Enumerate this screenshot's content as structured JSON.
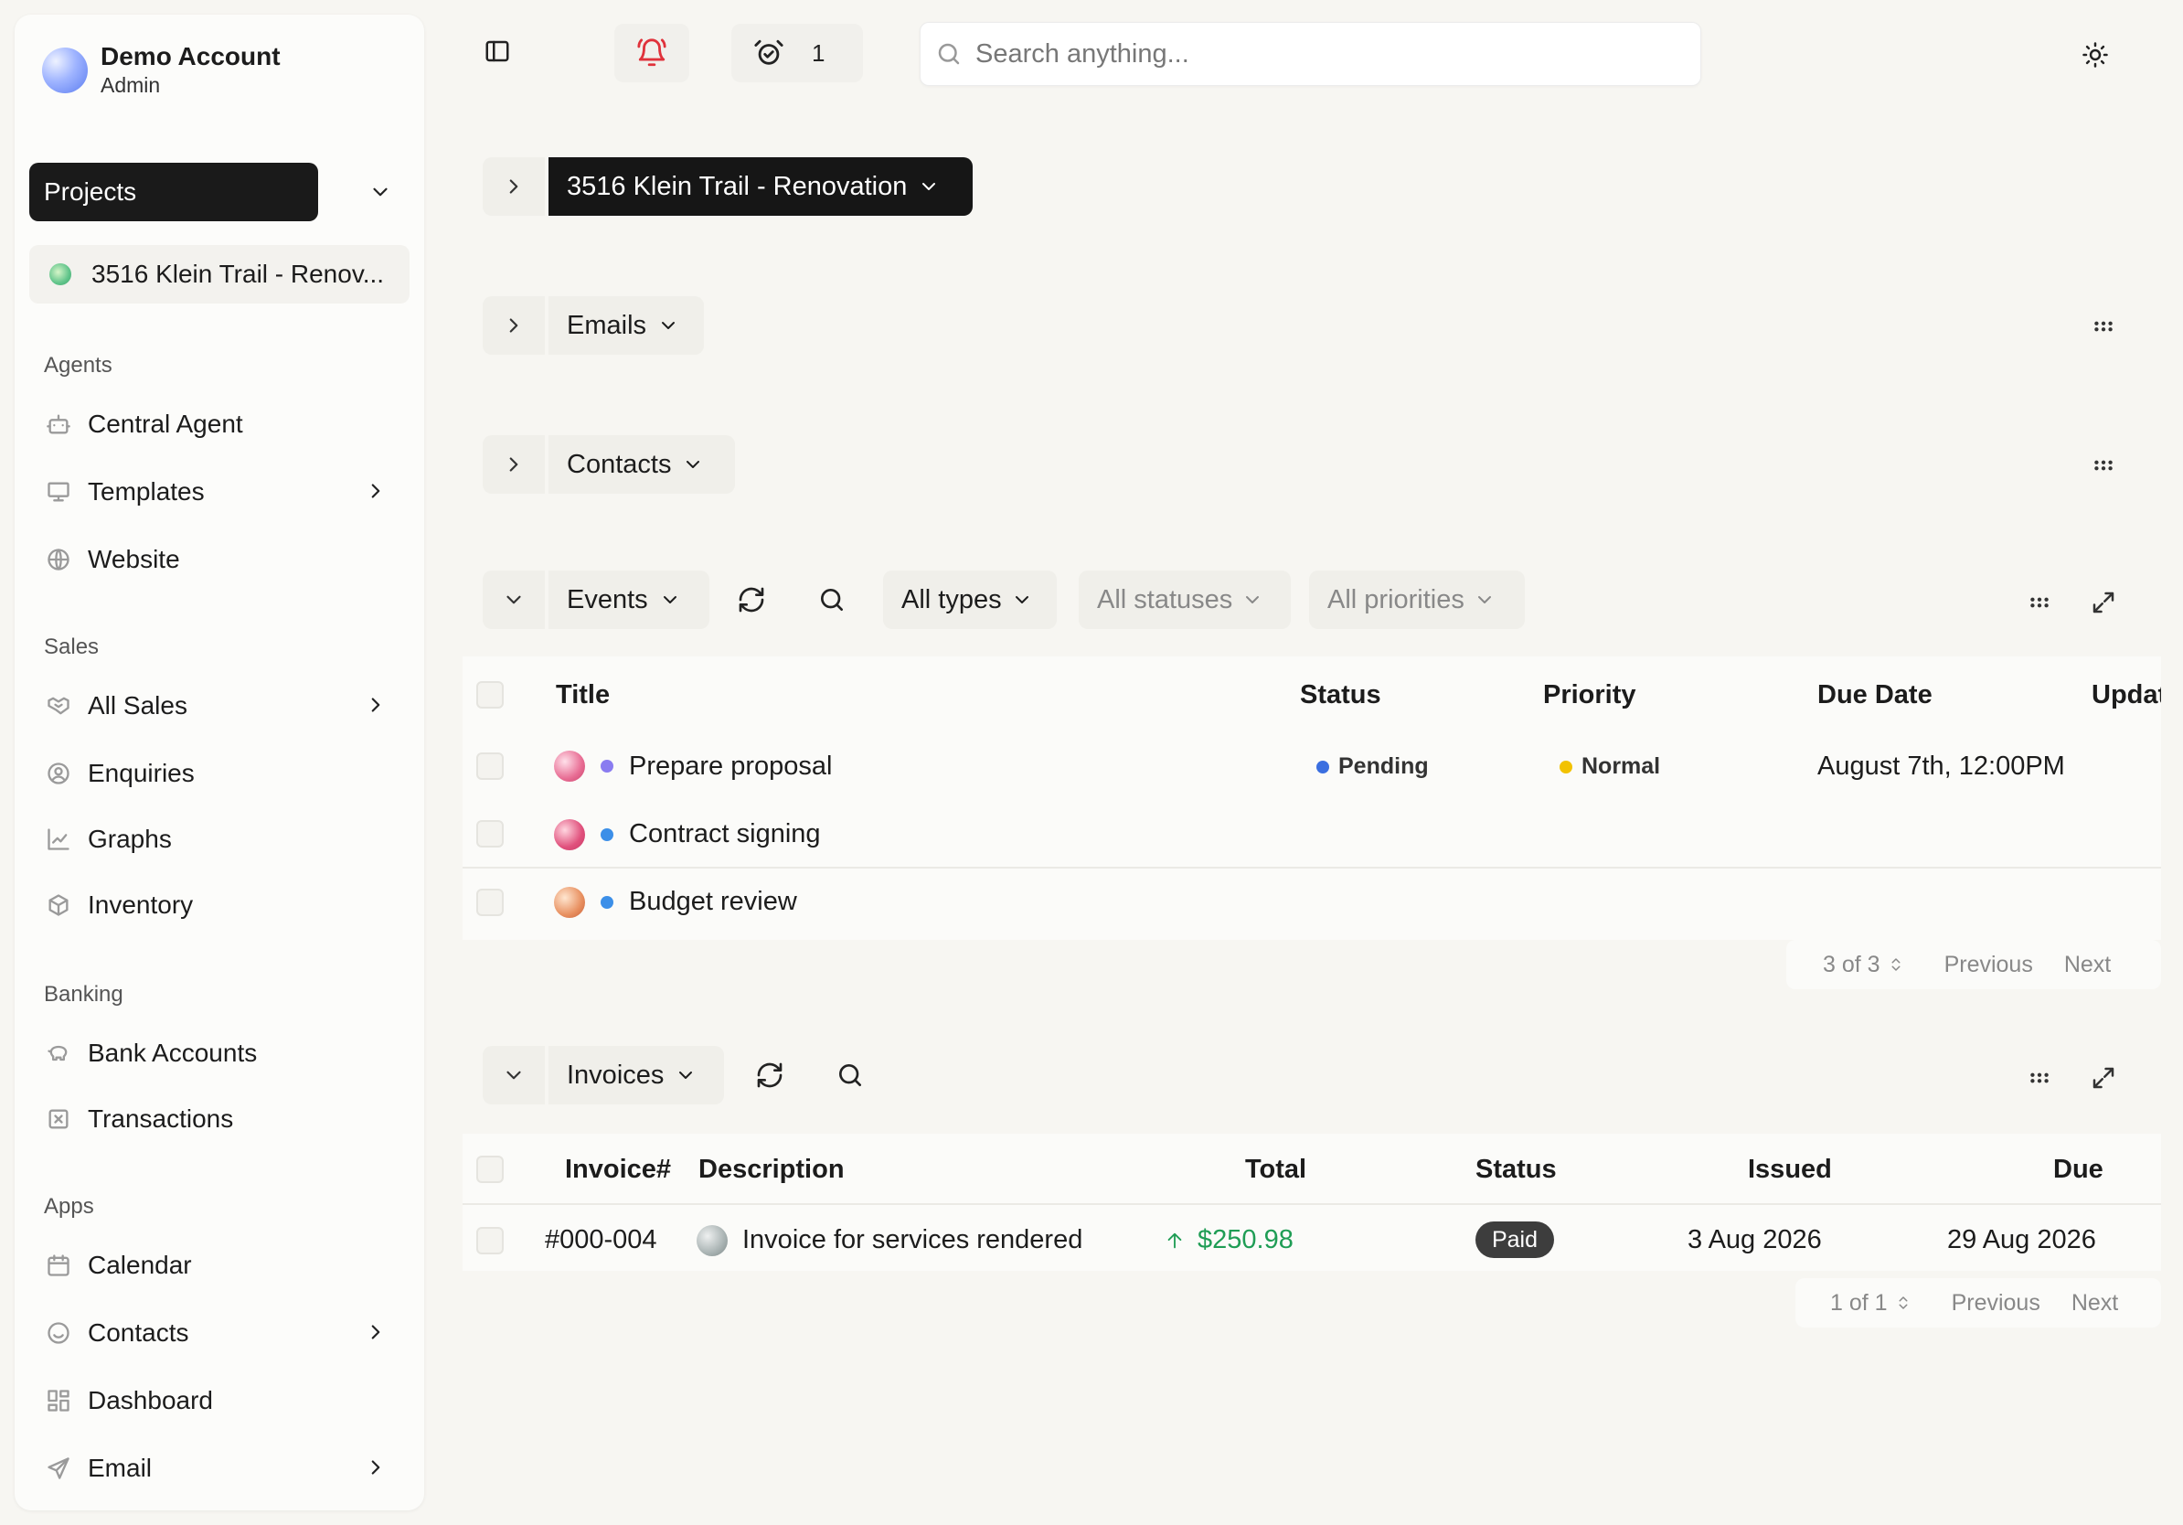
{
  "account": {
    "name": "Demo Account",
    "role": "Admin"
  },
  "sidebar": {
    "projects_label": "Projects",
    "project_item": "3516 Klein Trail - Renov...",
    "sections": {
      "agents": "Agents",
      "sales": "Sales",
      "banking": "Banking",
      "apps": "Apps"
    },
    "items": {
      "central_agent": "Central Agent",
      "templates": "Templates",
      "website": "Website",
      "all_sales": "All Sales",
      "enquiries": "Enquiries",
      "graphs": "Graphs",
      "inventory": "Inventory",
      "bank_accounts": "Bank Accounts",
      "transactions": "Transactions",
      "calendar": "Calendar",
      "contacts": "Contacts",
      "dashboard": "Dashboard",
      "email": "Email"
    }
  },
  "topbar": {
    "alarm_count": "1",
    "search_placeholder": "Search anything..."
  },
  "project_header": {
    "title": "3516 Klein Trail - Renovation"
  },
  "emails": {
    "label": "Emails"
  },
  "contacts": {
    "label": "Contacts"
  },
  "events": {
    "label": "Events",
    "filters": {
      "types": "All types",
      "statuses": "All statuses",
      "priorities": "All priorities"
    },
    "columns": {
      "title": "Title",
      "status": "Status",
      "priority": "Priority",
      "due_date": "Due Date",
      "updated": "Updat"
    },
    "rows": [
      {
        "title": "Prepare proposal",
        "status": "Pending",
        "priority": "Normal",
        "due": "August 7th, 12:00PM"
      },
      {
        "title": "Contract signing",
        "status": "",
        "priority": "",
        "due": ""
      },
      {
        "title": "Budget review",
        "status": "",
        "priority": "",
        "due": ""
      }
    ],
    "pager": {
      "count": "3 of 3",
      "previous": "Previous",
      "next": "Next"
    }
  },
  "invoices": {
    "label": "Invoices",
    "columns": {
      "invoice": "Invoice#",
      "description": "Description",
      "total": "Total",
      "status": "Status",
      "issued": "Issued",
      "due": "Due"
    },
    "rows": [
      {
        "invoice": "#000-004",
        "description": "Invoice for services rendered",
        "total": "$250.98",
        "status": "Paid",
        "issued": "3 Aug 2026",
        "due": "29 Aug 2026"
      }
    ],
    "pager": {
      "count": "1 of 1",
      "previous": "Previous",
      "next": "Next"
    }
  },
  "colors": {
    "status_pending": "#3b6fe0",
    "priority_normal": "#f2c200",
    "total_positive": "#1f9d55",
    "alert_red": "#e0323b"
  }
}
